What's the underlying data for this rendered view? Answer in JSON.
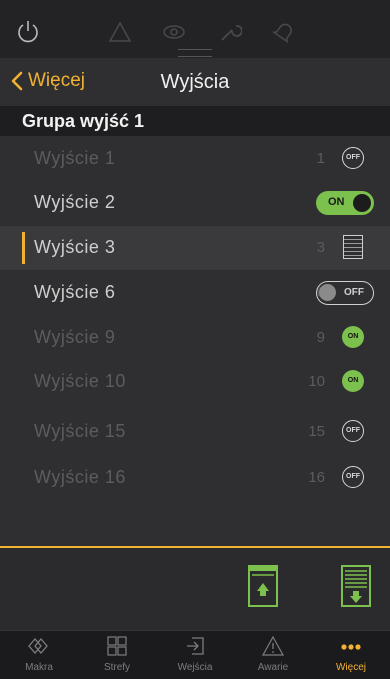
{
  "nav": {
    "back_label": "Więcej",
    "title": "Wyjścia"
  },
  "group": {
    "title": "Grupa wyjść 1"
  },
  "outputs": [
    {
      "name": "Wyjście  1",
      "number": "1",
      "state": "off",
      "control": "off-circle",
      "dim": true
    },
    {
      "name": "Wyjście  2",
      "number": "2",
      "state": "on",
      "control": "toggle-on",
      "toggle_label": "ON",
      "dim": false
    },
    {
      "name": "Wyjście  3",
      "number": "3",
      "state": "shutter",
      "control": "shutter",
      "dim": false,
      "selected": true
    },
    {
      "name": "Wyjście  6",
      "number": "6",
      "state": "off",
      "control": "toggle-off",
      "toggle_label": "OFF",
      "dim": false
    },
    {
      "name": "Wyjście  9",
      "number": "9",
      "state": "on",
      "control": "on-circle",
      "dim": true
    },
    {
      "name": "Wyjście  10",
      "number": "10",
      "state": "on",
      "control": "on-circle",
      "dim": true
    },
    {
      "name": "Wyjście  15",
      "number": "15",
      "state": "off",
      "control": "off-circle",
      "dim": true
    },
    {
      "name": "Wyjście  16",
      "number": "16",
      "state": "off",
      "control": "off-circle",
      "dim": true
    }
  ],
  "circle_labels": {
    "off": "OFF",
    "on": "ON"
  },
  "tabs": [
    {
      "label": "Makra",
      "icon": "macro-icon",
      "active": false
    },
    {
      "label": "Strefy",
      "icon": "zones-icon",
      "active": false
    },
    {
      "label": "Wejścia",
      "icon": "inputs-icon",
      "active": false
    },
    {
      "label": "Awarie",
      "icon": "warning-icon",
      "active": false
    },
    {
      "label": "Więcej",
      "icon": "more-icon",
      "active": true
    }
  ],
  "colors": {
    "accent": "#f1b233",
    "on": "#7cc04d",
    "background": "#2f2f31"
  }
}
